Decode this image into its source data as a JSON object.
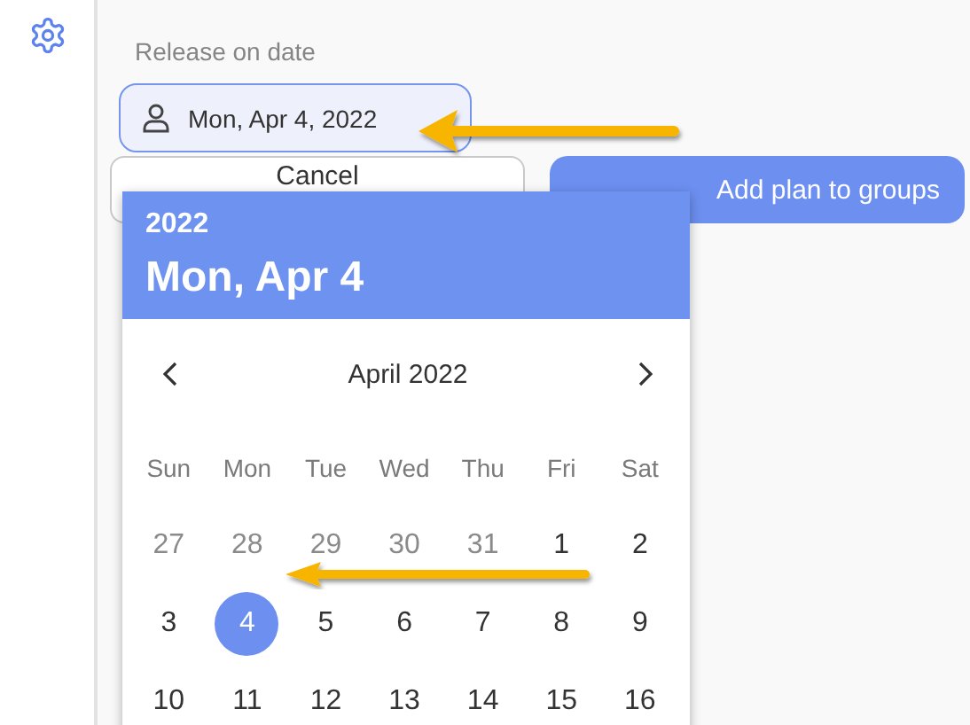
{
  "field": {
    "label": "Release on date",
    "value": "Mon, Apr 4, 2022"
  },
  "buttons": [
    {
      "kind": "secondary",
      "label": "Cancel"
    },
    {
      "kind": "primary",
      "label": "Add plan to groups"
    }
  ],
  "calendar": {
    "year": "2022",
    "heading": "Mon, Apr 4",
    "month": "April 2022",
    "weekdays": [
      "Sun",
      "Mon",
      "Tue",
      "Wed",
      "Thu",
      "Fri",
      "Sat"
    ],
    "days": [
      {
        "label": "27",
        "outside": true,
        "selected": false
      },
      {
        "label": "28",
        "outside": true,
        "selected": false
      },
      {
        "label": "29",
        "outside": true,
        "selected": false
      },
      {
        "label": "30",
        "outside": true,
        "selected": false
      },
      {
        "label": "31",
        "outside": true,
        "selected": false
      },
      {
        "label": "1",
        "outside": false,
        "selected": false
      },
      {
        "label": "2",
        "outside": false,
        "selected": false
      },
      {
        "label": "3",
        "outside": false,
        "selected": false
      },
      {
        "label": "4",
        "outside": false,
        "selected": true
      },
      {
        "label": "5",
        "outside": false,
        "selected": false
      },
      {
        "label": "6",
        "outside": false,
        "selected": false
      },
      {
        "label": "7",
        "outside": false,
        "selected": false
      },
      {
        "label": "8",
        "outside": false,
        "selected": false
      },
      {
        "label": "9",
        "outside": false,
        "selected": false
      },
      {
        "label": "10",
        "outside": false,
        "selected": false
      },
      {
        "label": "11",
        "outside": false,
        "selected": false
      },
      {
        "label": "12",
        "outside": false,
        "selected": false
      },
      {
        "label": "13",
        "outside": false,
        "selected": false
      },
      {
        "label": "14",
        "outside": false,
        "selected": false
      },
      {
        "label": "15",
        "outside": false,
        "selected": false
      },
      {
        "label": "16",
        "outside": false,
        "selected": false
      }
    ]
  }
}
